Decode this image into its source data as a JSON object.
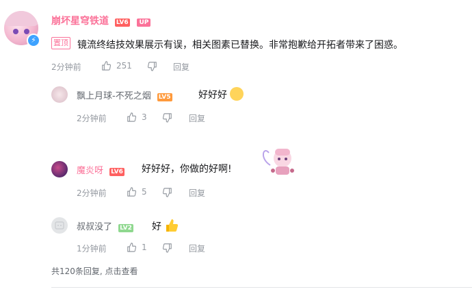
{
  "main_comment": {
    "username": "崩坏星穹铁道",
    "level": "LV6",
    "up_tag": "UP",
    "pinned_tag": "置顶",
    "content": "镜流终结技效果展示有误，相关图素已替换。非常抱歉给开拓者带来了困惑。",
    "time": "2分钟前",
    "like_count": "251",
    "reply_label": "回复"
  },
  "replies": [
    {
      "username": "飘上月球-不死之烟",
      "level": "LV5",
      "content": "好好好",
      "time": "2分钟前",
      "like_count": "3",
      "reply_label": "回复"
    },
    {
      "username": "魔炎呀",
      "level": "LV6",
      "content": "好好好，你做的好啊!",
      "time": "2分钟前",
      "like_count": "5",
      "reply_label": "回复"
    },
    {
      "username": "叔叔没了",
      "level": "LV2",
      "content": "好",
      "time": "1分钟前",
      "like_count": "1",
      "reply_label": "回复"
    }
  ],
  "footer": {
    "more_replies": "共120条回复, 点击查看"
  },
  "colors": {
    "accent_pink": "#fb7299",
    "meta_gray": "#9499a0",
    "lightning_blue": "#3ea2ff"
  }
}
